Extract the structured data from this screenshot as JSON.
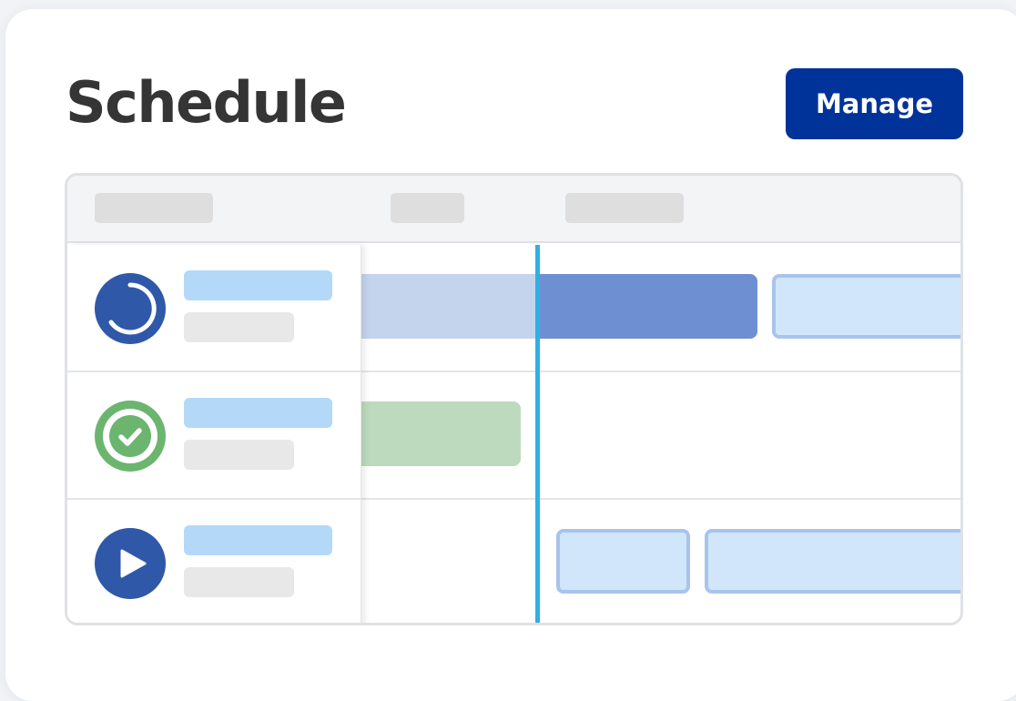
{
  "header": {
    "title": "Schedule",
    "manage_label": "Manage"
  },
  "colors": {
    "accent": "#003399",
    "now_line": "#2eb1e4",
    "progress_dark": "#3058a8",
    "progress_light": "#c5d4ed",
    "progress_bar": "#6e8fd1",
    "done_green": "#6cb56f",
    "done_bar": "#bddabe",
    "pending_fill": "#d1e6fb",
    "pending_border": "#a8c4eb"
  },
  "rows": [
    {
      "status_icon": "in-progress-icon"
    },
    {
      "status_icon": "check-circle-icon"
    },
    {
      "status_icon": "play-icon"
    }
  ]
}
